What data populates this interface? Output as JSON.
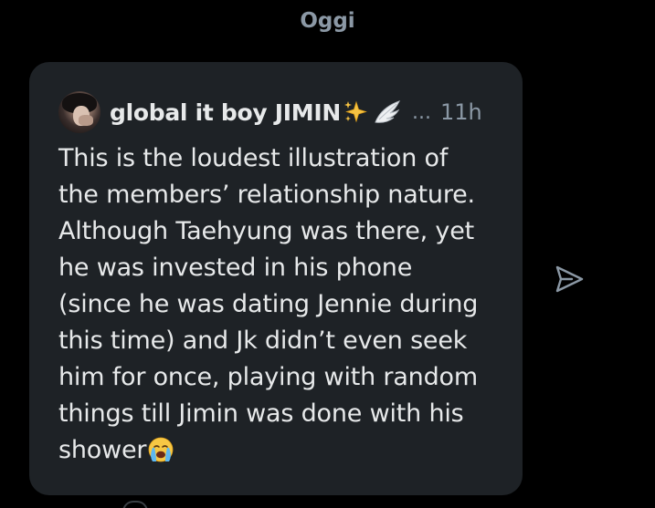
{
  "conversation": {
    "day_label": "Oggi"
  },
  "shared_post": {
    "author": "global it boy JIMIN",
    "author_badges": [
      "sparkles-emoji",
      "wing-emoji"
    ],
    "ellipsis": "...",
    "timestamp": "11h",
    "text": "This is the loudest illustration of\nthe members’ relationship nature.\nAlthough Taehyung was there, yet\nhe was invested in his phone\n(since he was dating Jennie during\nthis time) and Jk didn’t even seek\nhim for once, playing with random\nthings till Jimin was done with his\nshower",
    "trailing_emoji": "loudly-crying-face-emoji"
  },
  "actions": {
    "share_icon": "send-icon"
  },
  "colors": {
    "background": "#000000",
    "card": "#1e2226",
    "primary_text": "#e7e9ea",
    "secondary_text": "#8b98a5"
  }
}
